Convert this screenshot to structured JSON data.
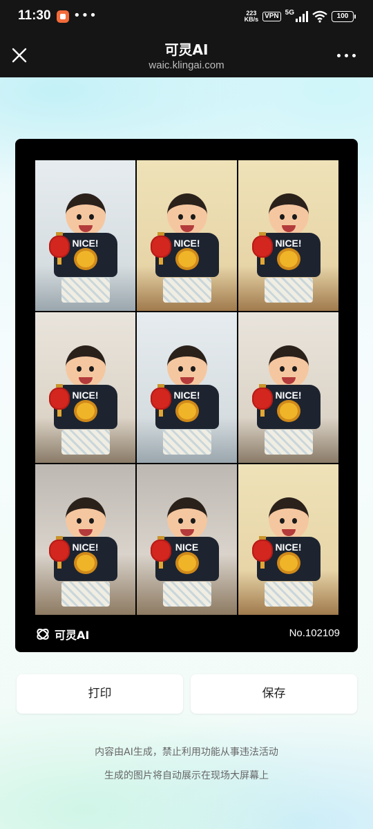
{
  "status_bar": {
    "time": "11:30",
    "net_speed_value": "223",
    "net_speed_unit": "KB/s",
    "vpn_label": "VPN",
    "network_type": "5G",
    "battery": "100"
  },
  "titlebar": {
    "title": "可灵AI",
    "url": "waic.klingai.com"
  },
  "card": {
    "brand_name": "可灵AI",
    "serial": "No.102109",
    "images": [
      {
        "shirt_text": "NICE!"
      },
      {
        "shirt_text": "NICE!"
      },
      {
        "shirt_text": "NICE!"
      },
      {
        "shirt_text": "NICE!"
      },
      {
        "shirt_text": "NICE!"
      },
      {
        "shirt_text": "NICE!"
      },
      {
        "shirt_text": "NICE!"
      },
      {
        "shirt_text": "NICE"
      },
      {
        "shirt_text": "NICE!"
      }
    ]
  },
  "actions": {
    "print_label": "打印",
    "save_label": "保存"
  },
  "notices": {
    "line1": "内容由AI生成，禁止利用功能从事违法活动",
    "line2": "生成的图片将自动展示在现场大屏幕上"
  }
}
